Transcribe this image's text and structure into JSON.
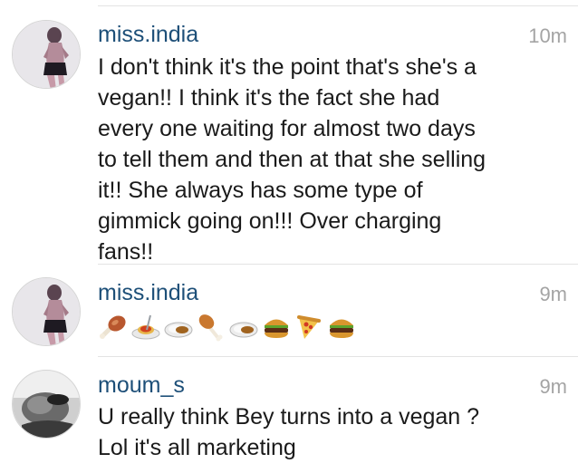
{
  "comments": [
    {
      "username": "miss.india",
      "time": "10m",
      "text": "I don't think it's the point that's she's a\nvegan!! I think it's the fact she had\nevery one waiting for almost two days\nto tell them and then at that she selling\nit!! She always has some type of\ngimmick going on!!! Over charging\nfans!!"
    },
    {
      "username": "miss.india",
      "time": "9m",
      "emojis": [
        "meat-on-bone",
        "spaghetti",
        "curry-rice",
        "poultry-leg",
        "curry-rice",
        "hamburger",
        "pizza",
        "hamburger"
      ]
    },
    {
      "username": "moum_s",
      "time": "9m",
      "text": "U really think Bey turns into a vegan ?\nLol it's all marketing"
    }
  ],
  "colors": {
    "username": "#1d4f78",
    "timestamp": "#a4a4a4",
    "body_text": "#1a1a1a",
    "divider": "#e3e3e3"
  }
}
